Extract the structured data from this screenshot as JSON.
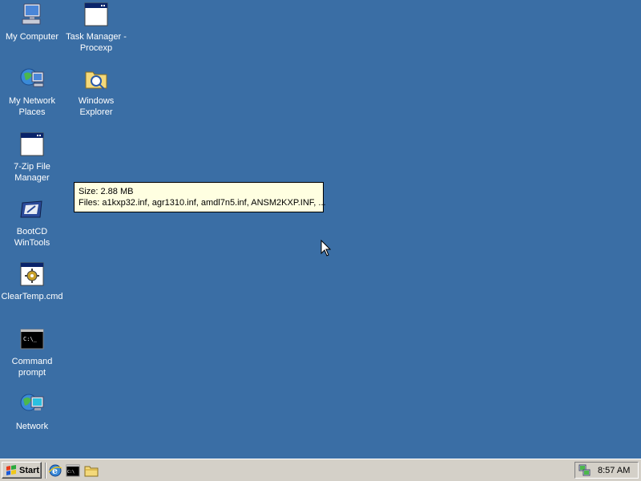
{
  "desktop": {
    "background_color": "#3a6ea5",
    "icons": [
      {
        "label": "My Computer",
        "icon": "my-computer-icon"
      },
      {
        "label": "Task Manager -\nProcexp",
        "icon": "window-icon"
      },
      {
        "label": "My Network\nPlaces",
        "icon": "network-places-icon"
      },
      {
        "label": "Windows\nExplorer",
        "icon": "explorer-folder-icon"
      },
      {
        "label": "7-Zip File\nManager",
        "icon": "window-icon"
      },
      {
        "label": "BootCD\nWinTools",
        "icon": "wintools-icon"
      },
      {
        "label": "ClearTemp.cmd",
        "icon": "batch-gear-icon"
      },
      {
        "label": "Command\nprompt",
        "icon": "command-prompt-icon"
      },
      {
        "label": "Network",
        "icon": "network-globe-icon"
      }
    ]
  },
  "tooltip": {
    "size_line": "Size: 2.88 MB",
    "files_line": "Files: a1kxp32.inf, agr1310.inf, amdl7n5.inf, ANSM2KXP.INF, ..."
  },
  "taskbar": {
    "start_label": "Start",
    "quick_launch": [
      "ie-icon",
      "cmd-icon",
      "folder-icon"
    ],
    "tray_icon": "network-tray-icon",
    "clock": "8:57 AM"
  }
}
